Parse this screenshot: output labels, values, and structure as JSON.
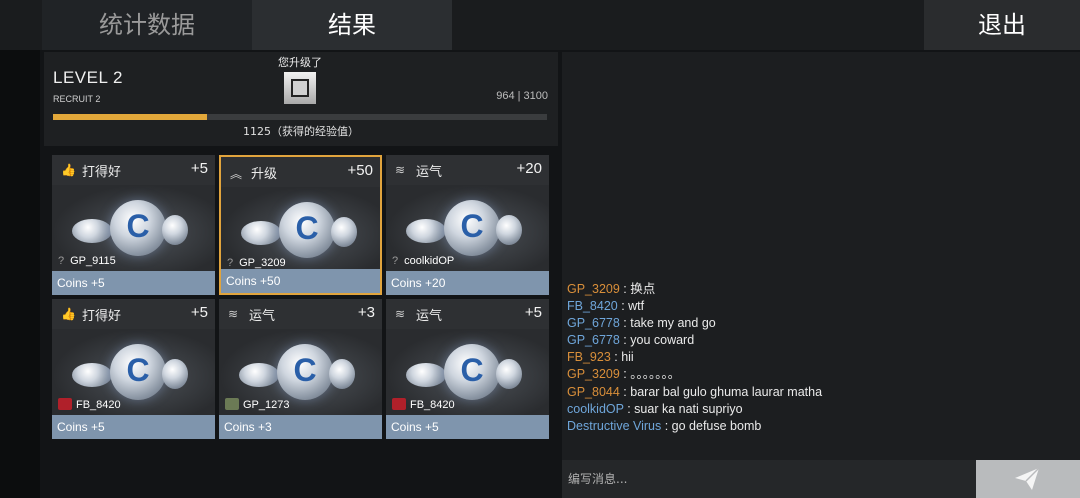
{
  "tabs": {
    "stats": "统计数据",
    "results": "结果",
    "exit": "退出"
  },
  "xp": {
    "level": "LEVEL 2",
    "rank": "RECRUIT 2",
    "upgrade_note": "您升级了",
    "current": "964 | 3100",
    "progress": 0.311,
    "gained": "1125（获得的经验值）"
  },
  "cards": [
    {
      "title": "打得好",
      "points": "+5",
      "player": "GP_9115",
      "reward": "Coins +5",
      "icon": "thumbs-up-icon"
    },
    {
      "title": "升级",
      "points": "+50",
      "player": "GP_3209",
      "reward": "Coins +50",
      "icon": "chevrons-up-icon"
    },
    {
      "title": "运气",
      "points": "+20",
      "player": "coolkidOP",
      "reward": "Coins +20",
      "icon": "luck-icon"
    },
    {
      "title": "打得好",
      "points": "+5",
      "player": "FB_8420",
      "reward": "Coins +5",
      "icon": "thumbs-up-icon"
    },
    {
      "title": "运气",
      "points": "+3",
      "player": "GP_1273",
      "reward": "Coins +3",
      "icon": "luck-icon"
    },
    {
      "title": "运气",
      "points": "+5",
      "player": "FB_8420",
      "reward": "Coins +5",
      "icon": "luck-icon"
    }
  ],
  "chat": {
    "messages": [
      {
        "name": "GP_3209",
        "text": "换点",
        "color": "#d98f3a"
      },
      {
        "name": "FB_8420",
        "text": "wtf",
        "color": "#6fa6da"
      },
      {
        "name": "GP_6778",
        "text": "take my and go",
        "color": "#6fa6da"
      },
      {
        "name": "GP_6778",
        "text": "you coward",
        "color": "#6fa6da"
      },
      {
        "name": "FB_923",
        "text": "hii",
        "color": "#d98f3a"
      },
      {
        "name": "GP_3209",
        "text": "。。。。。。。",
        "color": "#d98f3a"
      },
      {
        "name": "GP_8044",
        "text": "barar bal gulo ghuma laurar matha",
        "color": "#d98f3a"
      },
      {
        "name": "coolkidOP",
        "text": "suar ka nati supriyo",
        "color": "#6fa6da"
      },
      {
        "name": "Destructive Virus",
        "text": "go defuse bomb",
        "color": "#6fa6da"
      }
    ],
    "placeholder": "编写消息...",
    "send_icon": "send-icon"
  }
}
